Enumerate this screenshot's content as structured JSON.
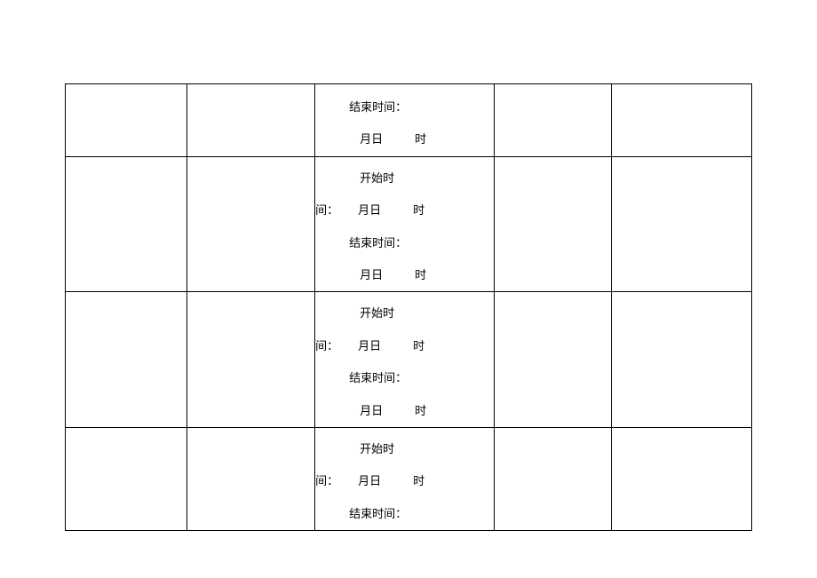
{
  "labels": {
    "start_time": "开始时",
    "start_suffix": "间：",
    "end_time": "结束时间：",
    "month_day": "月日",
    "hour": "时"
  },
  "rows": [
    {
      "has_start": false,
      "has_end": true,
      "has_date_line": true
    },
    {
      "has_start": true,
      "has_end": true,
      "has_date_line": true
    },
    {
      "has_start": true,
      "has_end": true,
      "has_date_line": true
    },
    {
      "has_start": true,
      "has_end": true,
      "has_date_line": false
    }
  ]
}
